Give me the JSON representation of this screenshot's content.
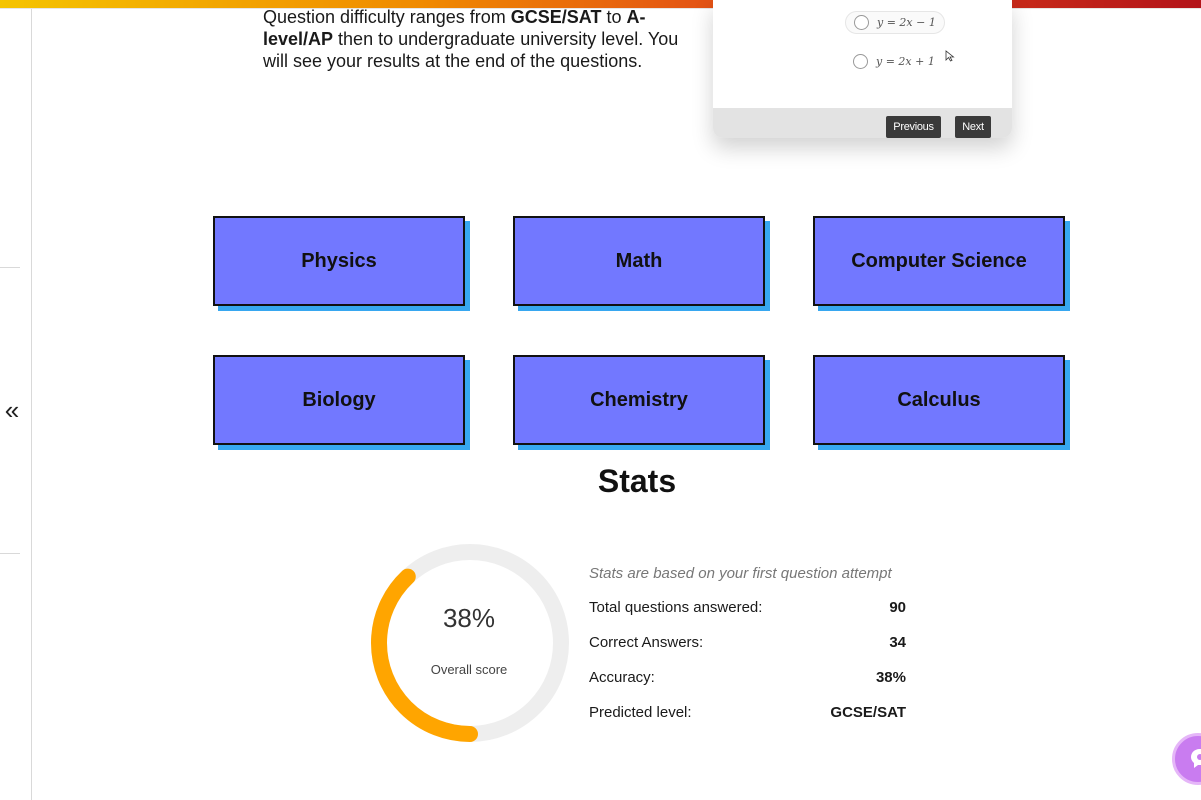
{
  "intro": {
    "part1": "Question difficulty ranges from ",
    "bold1": "GCSE/SAT",
    "part2": " to ",
    "bold2": "A-level/AP",
    "part3": " then to undergraduate university level. You will see your results at the end of the questions."
  },
  "preview": {
    "options": [
      "y = 2x − 1",
      "y = 2x + 1"
    ],
    "previous_label": "Previous",
    "next_label": "Next"
  },
  "subjects": [
    "Physics",
    "Math",
    "Computer Science",
    "Biology",
    "Chemistry",
    "Calculus"
  ],
  "stats": {
    "heading": "Stats",
    "overall_score": "38%",
    "overall_score_fraction": 0.38,
    "overall_label": "Overall score",
    "note": "Stats are based on your first question attempt",
    "rows": [
      {
        "label": "Total questions answered:",
        "value": "90"
      },
      {
        "label": "Correct Answers:",
        "value": "34"
      },
      {
        "label": "Accuracy:",
        "value": "38%"
      },
      {
        "label": "Predicted level:",
        "value": "GCSE/SAT"
      }
    ]
  },
  "colors": {
    "tile_fill": "#7278ff",
    "tile_shadow": "#37a7f0",
    "ring_progress": "#ffa500",
    "ring_track": "#eeeeee",
    "assistant": "#c97cf0"
  },
  "icons": {
    "collapse": "double-chevron-left-icon",
    "assistant": "assistant-bubble-icon",
    "cursor": "mouse-cursor-icon"
  }
}
